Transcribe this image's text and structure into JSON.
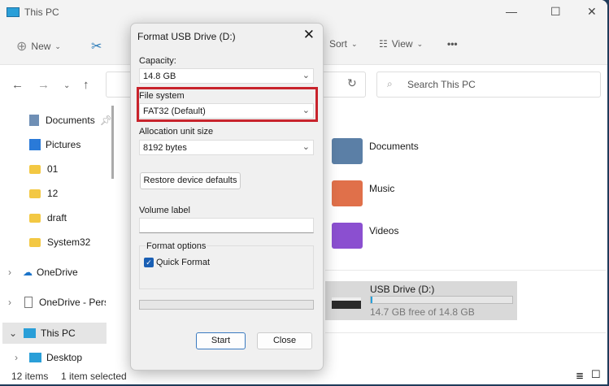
{
  "window": {
    "title": "This PC"
  },
  "toolbar": {
    "new": "New",
    "sort": "Sort",
    "view": "View",
    "more": "•••"
  },
  "search": {
    "placeholder": "Search This PC"
  },
  "sidebar": {
    "items": [
      {
        "label": "Documents",
        "icon": "documents-icon",
        "pinned": true
      },
      {
        "label": "Pictures",
        "icon": "pictures-icon",
        "pinned": true
      },
      {
        "label": "01",
        "icon": "folder-icon"
      },
      {
        "label": "12",
        "icon": "folder-icon"
      },
      {
        "label": "draft",
        "icon": "folder-icon"
      },
      {
        "label": "System32",
        "icon": "folder-icon"
      },
      {
        "label": "OneDrive",
        "icon": "cloud-icon"
      },
      {
        "label": "OneDrive - Perso",
        "icon": "file-icon"
      },
      {
        "label": "This PC",
        "icon": "monitor-icon",
        "selected": true
      },
      {
        "label": "Desktop",
        "icon": "desktop-icon"
      }
    ]
  },
  "content": {
    "libraries": [
      {
        "label": "Documents",
        "color": "#5b7fa6"
      },
      {
        "label": "Music",
        "color": "#e0704a"
      },
      {
        "label": "Videos",
        "color": "#8b4fd0"
      }
    ],
    "drive": {
      "name": "USB Drive (D:)",
      "free_text": "14.7 GB free of 14.8 GB",
      "used_fraction": 0.01
    }
  },
  "status": {
    "items": "12 items",
    "selected": "1 item selected"
  },
  "dialog": {
    "title": "Format USB Drive (D:)",
    "capacity_label": "Capacity:",
    "capacity_value": "14.8 GB",
    "fs_label": "File system",
    "fs_value": "FAT32 (Default)",
    "alloc_label": "Allocation unit size",
    "alloc_value": "8192 bytes",
    "restore": "Restore device defaults",
    "volume_label": "Volume label",
    "volume_value": "",
    "options_label": "Format options",
    "quick_format": "Quick Format",
    "quick_checked": true,
    "progress": 0,
    "start": "Start",
    "close": "Close",
    "highlight_color": "#c8232c"
  }
}
